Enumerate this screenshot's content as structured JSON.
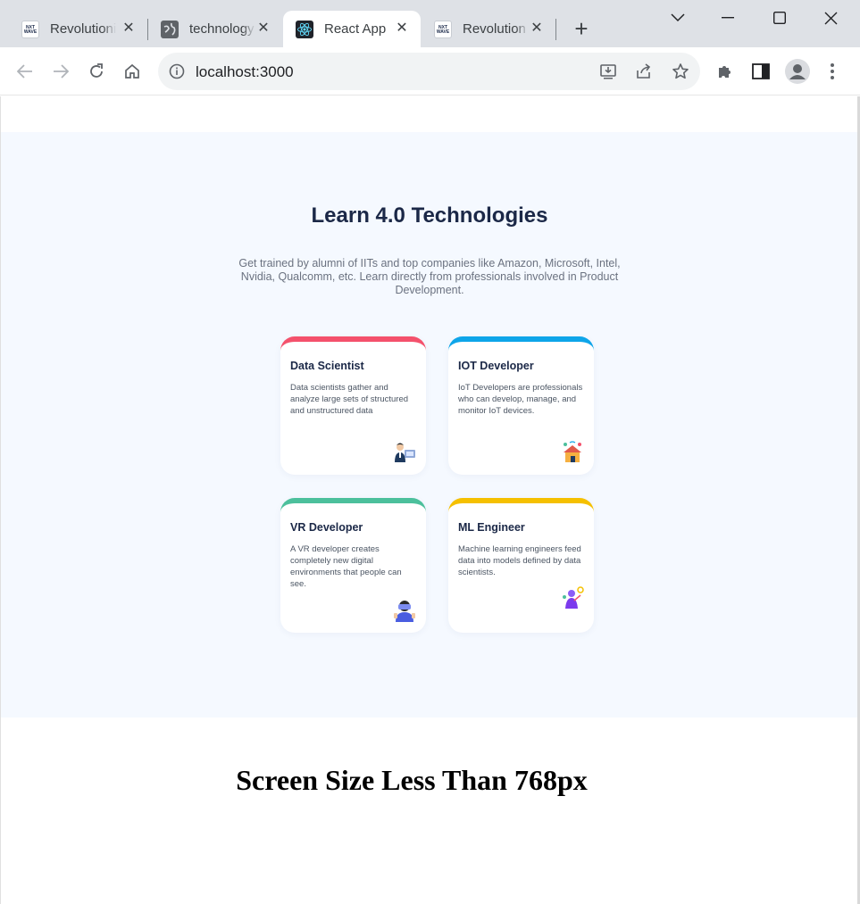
{
  "browser": {
    "tabs": [
      {
        "title": "Revolutionizi",
        "favicon": "nxtwave-logo"
      },
      {
        "title": "technology",
        "favicon": "globe-icon"
      },
      {
        "title": "React App",
        "favicon": "react-logo"
      },
      {
        "title": "Revolution",
        "favicon": "nxtwave-logo"
      }
    ],
    "favicon_text": "NXT WAVE",
    "close_glyph": "✕",
    "new_tab_glyph": "+",
    "url": "localhost:3000"
  },
  "page": {
    "heading": "Learn 4.0 Technologies",
    "subheading": "Get trained by alumni of IITs and top companies like Amazon, Microsoft, Intel, Nvidia, Qualcomm, etc. Learn directly from professionals involved in Product Development.",
    "cards": [
      {
        "title": "Data Scientist",
        "description": "Data scientists gather and analyze large sets of structured and unstructured data",
        "accent": "#f4516c",
        "icon": "data-scientist-illustration"
      },
      {
        "title": "IOT Developer",
        "description": "IoT Developers are professionals who can develop, manage, and monitor IoT devices.",
        "accent": "#0ea5e9",
        "icon": "iot-house-illustration"
      },
      {
        "title": "VR Developer",
        "description": "A VR developer creates completely new digital environments that people can see.",
        "accent": "#4cc09c",
        "icon": "vr-headset-illustration"
      },
      {
        "title": "ML Engineer",
        "description": "Machine learning engineers feed data into models defined by data scientists.",
        "accent": "#f5c000",
        "icon": "ml-robot-illustration"
      }
    ],
    "footer_heading": "Screen Size Less Than 768px"
  },
  "colors": {
    "section_bg": "#f5f9ff",
    "heading": "#1b2847",
    "tabbar": "#dee1e6"
  }
}
